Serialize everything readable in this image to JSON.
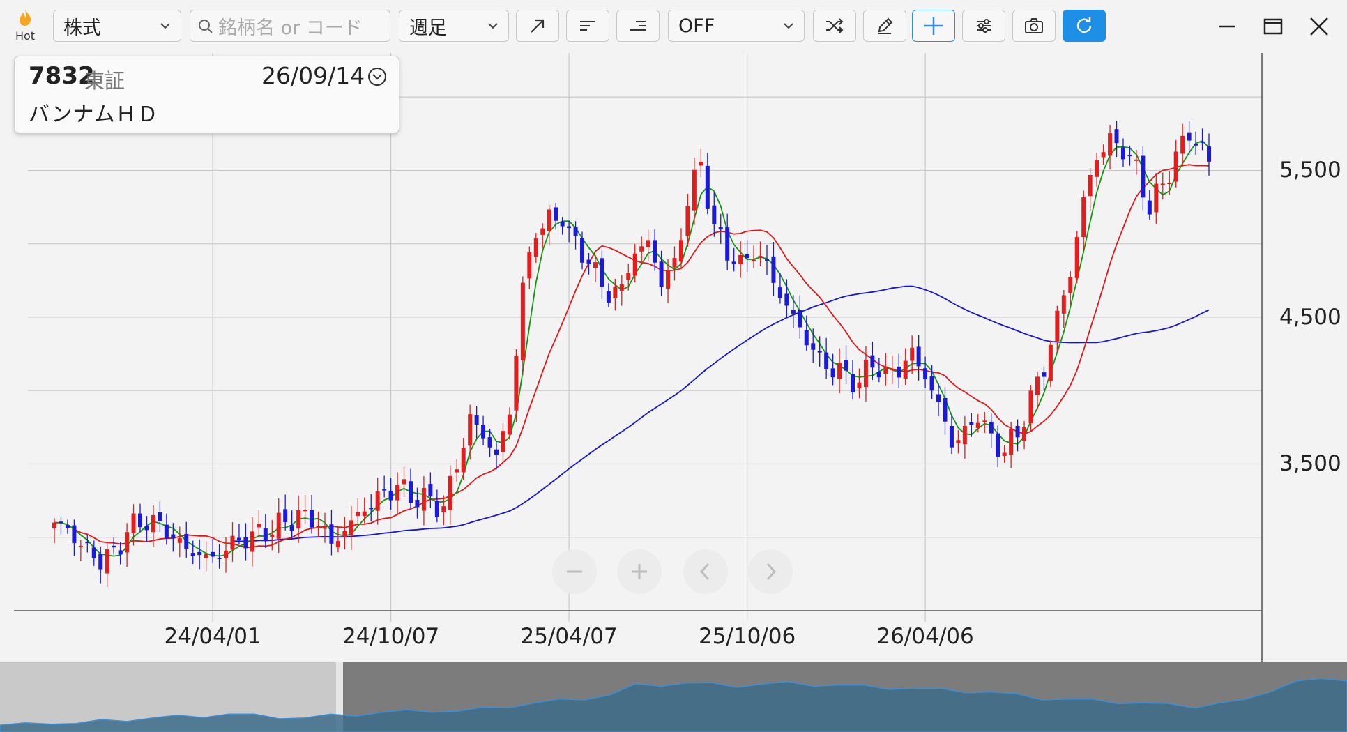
{
  "toolbar": {
    "hot_label": "Hot",
    "market_select": "株式",
    "search_placeholder": "銘柄名 or コード",
    "period_select": "週足",
    "indicator_select": "OFF"
  },
  "stock": {
    "code": "7832",
    "exchange": "東証",
    "date": "26/09/14",
    "name": "バンナムＨＤ"
  },
  "chart_data": {
    "type": "candlestick",
    "x_ticks": [
      "24/04/01",
      "24/10/07",
      "25/04/07",
      "25/10/06",
      "26/04/06"
    ],
    "y_ticks": [
      "5,500",
      "4,500",
      "3,500"
    ],
    "y_tick_values": [
      5500,
      4500,
      3500
    ],
    "ylim": [
      2500,
      6300
    ],
    "n_weeks": 176,
    "x_tick_indices": [
      24,
      51,
      78,
      105,
      132
    ],
    "grid": true,
    "colors": {
      "up": "#e21e1e",
      "down": "#1b1bd6",
      "ma_short": "#129612",
      "ma_mid": "#e01818",
      "ma_long": "#1616cc"
    },
    "close_anchors": [
      [
        0,
        3100
      ],
      [
        2,
        3050
      ],
      [
        5,
        2900
      ],
      [
        7,
        2850
      ],
      [
        9,
        2880
      ],
      [
        11,
        3050
      ],
      [
        14,
        3120
      ],
      [
        17,
        3050
      ],
      [
        19,
        2950
      ],
      [
        21,
        2900
      ],
      [
        24,
        2850
      ],
      [
        26,
        2930
      ],
      [
        29,
        3000
      ],
      [
        31,
        3020
      ],
      [
        34,
        3080
      ],
      [
        37,
        3150
      ],
      [
        40,
        3100
      ],
      [
        42,
        2950
      ],
      [
        44,
        3050
      ],
      [
        47,
        3200
      ],
      [
        50,
        3300
      ],
      [
        52,
        3350
      ],
      [
        54,
        3280
      ],
      [
        57,
        3250
      ],
      [
        59,
        3200
      ],
      [
        61,
        3500
      ],
      [
        63,
        3800
      ],
      [
        65,
        3700
      ],
      [
        67,
        3550
      ],
      [
        69,
        3850
      ],
      [
        71,
        4700
      ],
      [
        73,
        5100
      ],
      [
        75,
        5150
      ],
      [
        77,
        5200
      ],
      [
        78,
        5050
      ],
      [
        80,
        4950
      ],
      [
        82,
        4800
      ],
      [
        84,
        4650
      ],
      [
        86,
        4700
      ],
      [
        88,
        4950
      ],
      [
        90,
        5000
      ],
      [
        92,
        4750
      ],
      [
        94,
        4850
      ],
      [
        96,
        5300
      ],
      [
        98,
        5550
      ],
      [
        100,
        5100
      ],
      [
        102,
        4950
      ],
      [
        104,
        4850
      ],
      [
        106,
        4950
      ],
      [
        108,
        4850
      ],
      [
        110,
        4650
      ],
      [
        112,
        4500
      ],
      [
        114,
        4350
      ],
      [
        116,
        4200
      ],
      [
        118,
        4150
      ],
      [
        120,
        4100
      ],
      [
        122,
        4050
      ],
      [
        124,
        4200
      ],
      [
        126,
        4100
      ],
      [
        128,
        4150
      ],
      [
        130,
        4250
      ],
      [
        132,
        4100
      ],
      [
        134,
        3900
      ],
      [
        136,
        3650
      ],
      [
        138,
        3700
      ],
      [
        140,
        3850
      ],
      [
        142,
        3650
      ],
      [
        144,
        3600
      ],
      [
        146,
        3700
      ],
      [
        148,
        3950
      ],
      [
        150,
        4150
      ],
      [
        152,
        4500
      ],
      [
        154,
        4800
      ],
      [
        156,
        5300
      ],
      [
        158,
        5600
      ],
      [
        160,
        5700
      ],
      [
        162,
        5650
      ],
      [
        164,
        5500
      ],
      [
        166,
        5250
      ],
      [
        168,
        5400
      ],
      [
        170,
        5600
      ],
      [
        172,
        5750
      ],
      [
        174,
        5650
      ],
      [
        175,
        5550
      ]
    ]
  },
  "navigator_data": {
    "values": [
      0.05,
      0.06,
      0.1,
      0.08,
      0.12,
      0.15,
      0.18,
      0.2,
      0.22,
      0.25,
      0.22,
      0.2,
      0.18,
      0.22,
      0.25,
      0.28,
      0.3,
      0.32,
      0.3,
      0.35,
      0.4,
      0.45,
      0.5,
      0.55,
      0.6,
      0.78,
      0.8,
      0.82,
      0.8,
      0.78,
      0.8,
      0.82,
      0.8,
      0.78,
      0.76,
      0.74,
      0.72,
      0.7,
      0.68,
      0.65,
      0.6,
      0.55,
      0.52,
      0.5,
      0.48,
      0.45,
      0.42,
      0.4,
      0.45,
      0.5,
      0.7,
      0.85,
      0.88,
      0.9
    ]
  }
}
